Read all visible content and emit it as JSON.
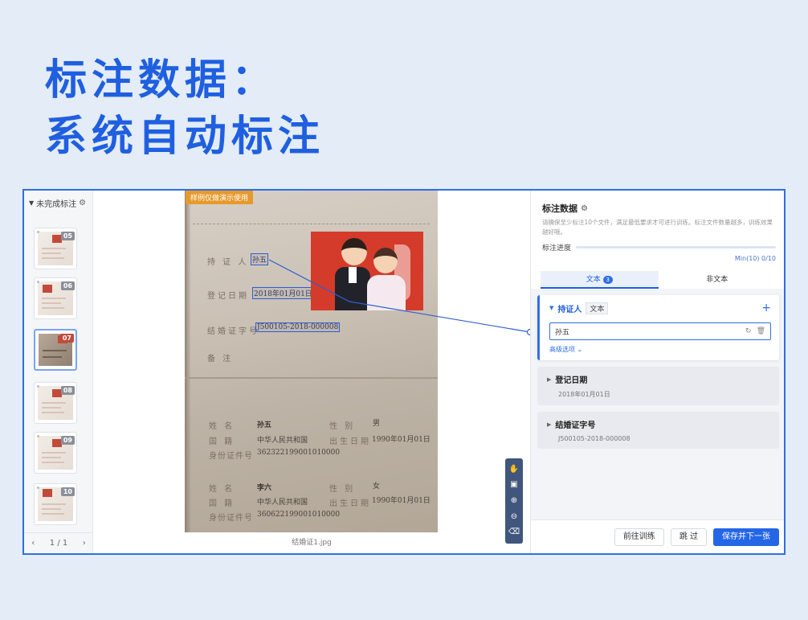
{
  "headline": {
    "line1": "标注数据：",
    "line2": "系统自动标注"
  },
  "left_panel": {
    "header_label": "未完成标注",
    "thumbnails": [
      {
        "num": "05"
      },
      {
        "num": "06"
      },
      {
        "num": "07"
      },
      {
        "num": "08"
      },
      {
        "num": "09"
      },
      {
        "num": "10"
      }
    ],
    "pager": {
      "prev": "‹",
      "current": "1",
      "sep": "/",
      "total": "1",
      "next": "›"
    }
  },
  "canvas": {
    "watermark": "样例仅做演示使用",
    "filename": "结婚证1.jpg",
    "doc": {
      "holder_label": "持 证 人",
      "holder_value": "孙五",
      "date_label": "登记日期",
      "date_value": "2018年01月01日",
      "cert_label": "结婚证字号",
      "cert_value": "J500105-2018-000008",
      "remark_label": "备 注",
      "p1_name_label": "姓 名",
      "p1_name": "孙五",
      "p1_gender_label": "性 别",
      "p1_gender": "男",
      "p1_nation_label": "国 籍",
      "p1_nation": "中华人民共和国",
      "p1_birth_label": "出生日期",
      "p1_birth": "1990年01月01日",
      "p1_id_label": "身份证件号",
      "p1_id": "362322199001010000",
      "p2_name_label": "姓 名",
      "p2_name": "李六",
      "p2_gender_label": "性 别",
      "p2_gender": "女",
      "p2_nation_label": "国 籍",
      "p2_nation": "中华人民共和国",
      "p2_birth_label": "出生日期",
      "p2_birth": "1990年01月01日",
      "p2_id_label": "身份证件号",
      "p2_id": "360622199001010000"
    }
  },
  "right_panel": {
    "title": "标注数据",
    "desc": "请确保至少标注10个文件，满足最低要求才可进行训练。标注文件数量越多，训练效果越好哦。",
    "progress_label": "标注进度",
    "progress_count": "Min(10) 0/10",
    "tabs": [
      {
        "label": "文本",
        "badge": "3"
      },
      {
        "label": "非文本"
      }
    ],
    "fields": [
      {
        "name": "持证人",
        "type": "文本",
        "value": "孙五",
        "more": "高级选项"
      },
      {
        "name": "登记日期",
        "value": "2018年01月01日"
      },
      {
        "name": "结婚证字号",
        "value": "J500105-2018-000008"
      }
    ],
    "buttons": {
      "train": "前往训练",
      "skip": "跳 过",
      "save": "保存并下一张"
    }
  },
  "colors": {
    "accent": "#1f5fe0",
    "primary_button": "#2466e6",
    "watermark": "#e69a2e",
    "toolbar": "#40567c"
  },
  "icons": [
    "gear-icon",
    "caret-down-icon",
    "caret-right-icon",
    "plus-icon",
    "refresh-icon",
    "delete-icon",
    "hand-icon",
    "select-icon",
    "zoom-in-icon",
    "zoom-out-icon",
    "clear-icon"
  ]
}
